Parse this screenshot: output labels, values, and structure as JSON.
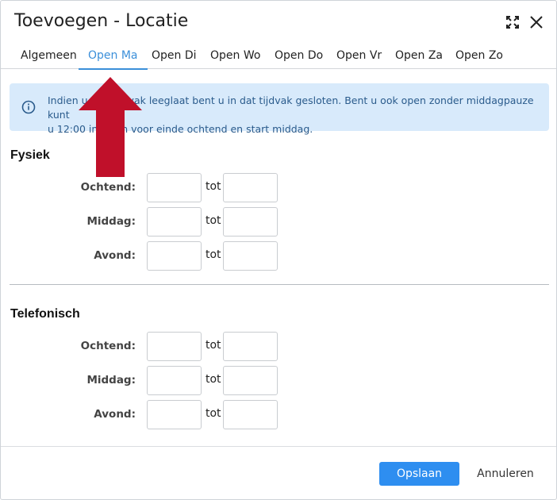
{
  "dialog": {
    "title": "Toevoegen - Locatie"
  },
  "tabs": [
    {
      "label": "Algemeen",
      "active": false
    },
    {
      "label": "Open Ma",
      "active": true
    },
    {
      "label": "Open Di",
      "active": false
    },
    {
      "label": "Open Wo",
      "active": false
    },
    {
      "label": "Open Do",
      "active": false
    },
    {
      "label": "Open Vr",
      "active": false
    },
    {
      "label": "Open Za",
      "active": false
    },
    {
      "label": "Open Zo",
      "active": false
    }
  ],
  "info": {
    "line1": "Indien u een tijdvak leeglaat bent u in dat tijdvak gesloten. Bent u ook open zonder middagpauze kunt",
    "line2": "u 12:00 invullen voor einde ochtend en start middag."
  },
  "fysiek": {
    "title": "Fysiek",
    "rows": [
      {
        "label": "Ochtend:",
        "sep": "tot",
        "from": "",
        "to": ""
      },
      {
        "label": "Middag:",
        "sep": "tot",
        "from": "",
        "to": ""
      },
      {
        "label": "Avond:",
        "sep": "tot",
        "from": "",
        "to": ""
      }
    ]
  },
  "telefonisch": {
    "title": "Telefonisch",
    "rows": [
      {
        "label": "Ochtend:",
        "sep": "tot",
        "from": "",
        "to": ""
      },
      {
        "label": "Middag:",
        "sep": "tot",
        "from": "",
        "to": ""
      },
      {
        "label": "Avond:",
        "sep": "tot",
        "from": "",
        "to": ""
      }
    ]
  },
  "footer": {
    "save_label": "Opslaan",
    "cancel_label": "Annuleren"
  },
  "colors": {
    "accent": "#2e8ef0",
    "info_bg": "#d8eafb",
    "annotation_arrow": "#c0102a"
  },
  "icons": {
    "expand": "expand-icon",
    "close": "close-icon",
    "info": "info-icon"
  }
}
